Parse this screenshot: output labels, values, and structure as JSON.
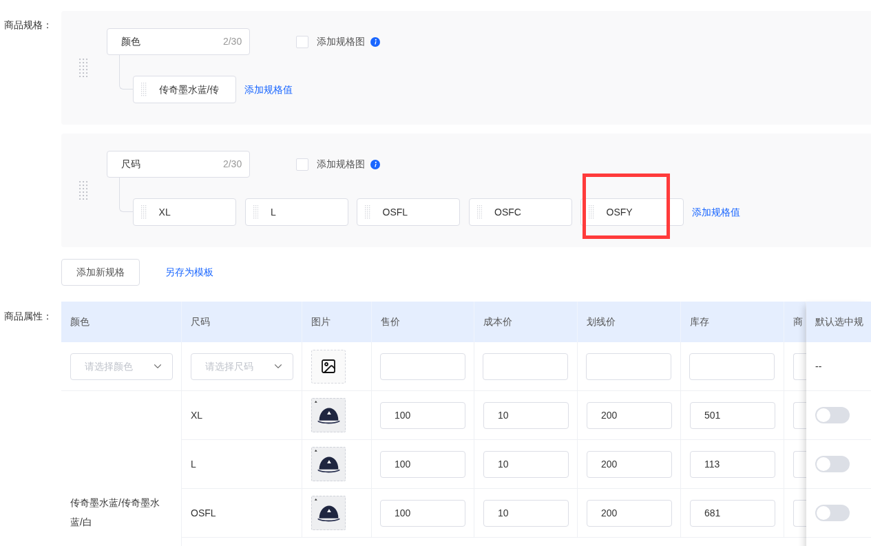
{
  "spec_section": {
    "label": "商品规格：",
    "groups": [
      {
        "name": "颜色",
        "counter": "2/30",
        "image_option": {
          "label": "添加规格图",
          "checked": false
        },
        "values": [
          {
            "text": "传奇墨水蓝/传",
            "highlighted": false
          }
        ],
        "add_value_link": "添加规格值"
      },
      {
        "name": "尺码",
        "counter": "2/30",
        "image_option": {
          "label": "添加规格图",
          "checked": false
        },
        "values": [
          {
            "text": "XL",
            "highlighted": false
          },
          {
            "text": "L",
            "highlighted": false
          },
          {
            "text": "OSFL",
            "highlighted": false
          },
          {
            "text": "OSFC",
            "highlighted": false
          },
          {
            "text": "OSFY",
            "highlighted": true
          }
        ],
        "add_value_link": "添加规格值"
      }
    ],
    "add_spec_button": "添加新规格",
    "save_template_link": "另存为模板"
  },
  "attributes_section": {
    "label": "商品属性：",
    "table": {
      "columns": [
        "颜色",
        "尺码",
        "图片",
        "售价",
        "成本价",
        "划线价",
        "库存",
        "商",
        "默认选中规"
      ],
      "filter_row": {
        "color_select": {
          "placeholder": "请选择颜色"
        },
        "size_select": {
          "placeholder": "请选择尺码"
        },
        "default_cell": "--"
      },
      "color_group": "传奇墨水蓝/传奇墨水蓝/白",
      "rows": [
        {
          "size": "XL",
          "price": "100",
          "cost_price": "10",
          "list_price": "200",
          "stock": "501",
          "default_on": false
        },
        {
          "size": "L",
          "price": "100",
          "cost_price": "10",
          "list_price": "200",
          "stock": "113",
          "default_on": false
        },
        {
          "size": "OSFL",
          "price": "100",
          "cost_price": "10",
          "list_price": "200",
          "stock": "681",
          "default_on": false
        }
      ]
    }
  }
}
